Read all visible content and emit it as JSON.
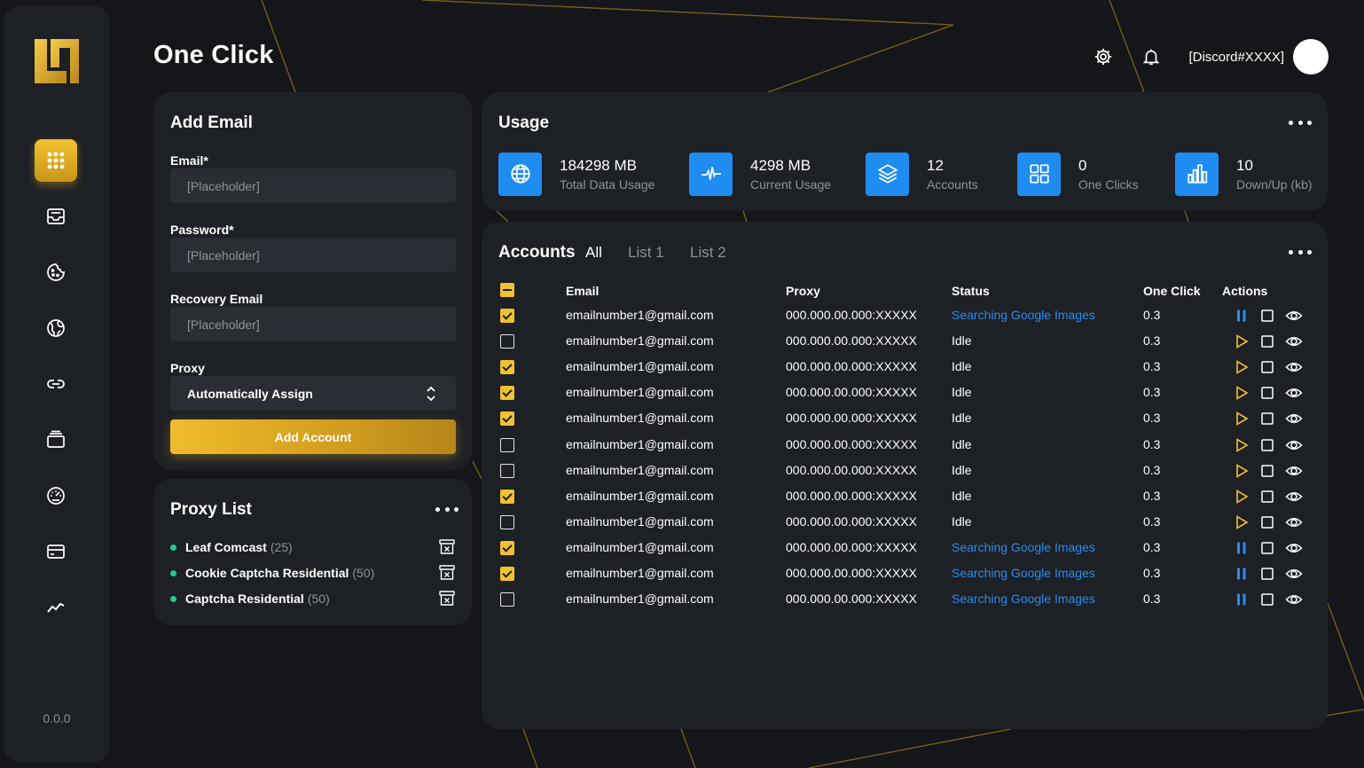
{
  "app": {
    "title": "One Click",
    "version": "0.0.0",
    "user": "[Discord#XXXX]",
    "accent_gold": "#f0c130",
    "accent_blue": "#1f8cf1",
    "accent_green": "#1fcf87"
  },
  "sidebar": {
    "items": [
      {
        "icon": "grid-icon",
        "active": true
      },
      {
        "icon": "inbox-icon",
        "active": false
      },
      {
        "icon": "cookie-icon",
        "active": false
      },
      {
        "icon": "globe-icon",
        "active": false
      },
      {
        "icon": "link-icon",
        "active": false
      },
      {
        "icon": "stack-icon",
        "active": false
      },
      {
        "icon": "gauge-icon",
        "active": false
      },
      {
        "icon": "card-icon",
        "active": false
      },
      {
        "icon": "trend-icon",
        "active": false
      }
    ]
  },
  "add_email": {
    "title": "Add Email",
    "email_label": "Email*",
    "email_placeholder": "[Placeholder]",
    "password_label": "Password*",
    "password_placeholder": "[Placeholder]",
    "recovery_label": "Recovery Email",
    "recovery_placeholder": "[Placeholder]",
    "proxy_label": "Proxy",
    "proxy_value": "Automatically Assign",
    "submit_label": "Add Account"
  },
  "proxy_list": {
    "title": "Proxy List",
    "items": [
      {
        "name": "Leaf Comcast",
        "count": "(25)"
      },
      {
        "name": "Cookie Captcha Residential",
        "count": "(50)"
      },
      {
        "name": "Captcha Residential",
        "count": "(50)"
      }
    ]
  },
  "usage": {
    "title": "Usage",
    "stats": [
      {
        "icon": "globe-icon",
        "value": "184298 MB",
        "label": "Total Data Usage"
      },
      {
        "icon": "pulse-icon",
        "value": "4298 MB",
        "label": "Current Usage"
      },
      {
        "icon": "layers-icon",
        "value": "12",
        "label": "Accounts"
      },
      {
        "icon": "grid-icon",
        "value": "0",
        "label": "One Clicks"
      },
      {
        "icon": "bar-chart-icon",
        "value": "10",
        "label": "Down/Up (kb)"
      }
    ]
  },
  "accounts": {
    "title": "Accounts",
    "tabs": [
      "All",
      "List 1",
      "List 2"
    ],
    "active_tab": 0,
    "columns": {
      "email": "Email",
      "proxy": "Proxy",
      "status": "Status",
      "one_click": "One Click",
      "actions": "Actions"
    },
    "rows": [
      {
        "checked": true,
        "email": "emailnumber1@gmail.com",
        "proxy": "000.000.00.000:XXXXX",
        "status": "Searching Google Images",
        "one_click": "0.3",
        "running": true
      },
      {
        "checked": false,
        "email": "emailnumber1@gmail.com",
        "proxy": "000.000.00.000:XXXXX",
        "status": "Idle",
        "one_click": "0.3",
        "running": false
      },
      {
        "checked": true,
        "email": "emailnumber1@gmail.com",
        "proxy": "000.000.00.000:XXXXX",
        "status": "Idle",
        "one_click": "0.3",
        "running": false
      },
      {
        "checked": true,
        "email": "emailnumber1@gmail.com",
        "proxy": "000.000.00.000:XXXXX",
        "status": "Idle",
        "one_click": "0.3",
        "running": false
      },
      {
        "checked": true,
        "email": "emailnumber1@gmail.com",
        "proxy": "000.000.00.000:XXXXX",
        "status": "Idle",
        "one_click": "0.3",
        "running": false
      },
      {
        "checked": false,
        "email": "emailnumber1@gmail.com",
        "proxy": "000.000.00.000:XXXXX",
        "status": "Idle",
        "one_click": "0.3",
        "running": false
      },
      {
        "checked": false,
        "email": "emailnumber1@gmail.com",
        "proxy": "000.000.00.000:XXXXX",
        "status": "Idle",
        "one_click": "0.3",
        "running": false
      },
      {
        "checked": true,
        "email": "emailnumber1@gmail.com",
        "proxy": "000.000.00.000:XXXXX",
        "status": "Idle",
        "one_click": "0.3",
        "running": false
      },
      {
        "checked": false,
        "email": "emailnumber1@gmail.com",
        "proxy": "000.000.00.000:XXXXX",
        "status": "Idle",
        "one_click": "0.3",
        "running": false
      },
      {
        "checked": true,
        "email": "emailnumber1@gmail.com",
        "proxy": "000.000.00.000:XXXXX",
        "status": "Searching Google Images",
        "one_click": "0.3",
        "running": true
      },
      {
        "checked": true,
        "email": "emailnumber1@gmail.com",
        "proxy": "000.000.00.000:XXXXX",
        "status": "Searching Google Images",
        "one_click": "0.3",
        "running": true
      },
      {
        "checked": false,
        "email": "emailnumber1@gmail.com",
        "proxy": "000.000.00.000:XXXXX",
        "status": "Searching Google Images",
        "one_click": "0.3",
        "running": true
      }
    ]
  }
}
